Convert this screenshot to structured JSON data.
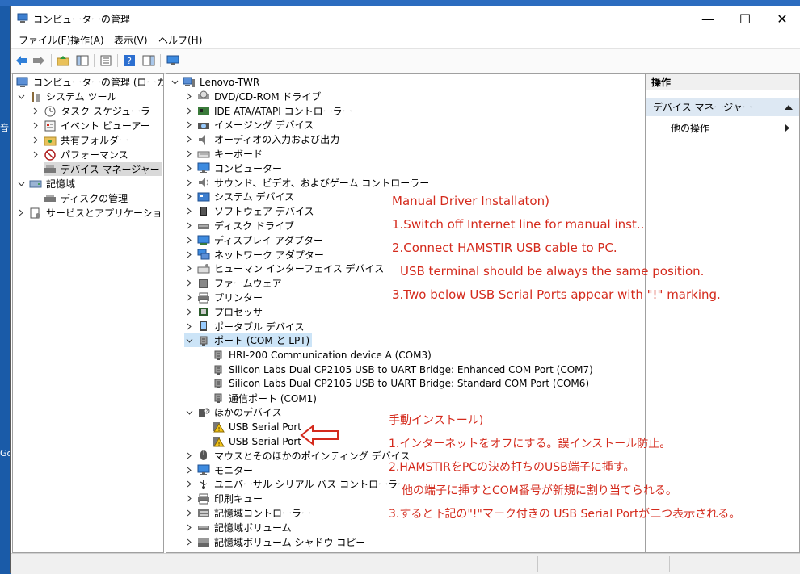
{
  "window": {
    "title": "コンピューターの管理",
    "minimize": "—",
    "maximize": "☐",
    "close": "✕"
  },
  "desktop_fragments": [
    "音",
    "Go"
  ],
  "menu": [
    "ファイル(F)",
    "操作(A)",
    "表示(V)",
    "ヘルプ(H)"
  ],
  "toolbar_icons": [
    "back-arrow-icon",
    "forward-arrow-icon",
    "up-folder-icon",
    "show-hide-tree-icon",
    "properties-icon",
    "help-icon",
    "action-pane-icon",
    "monitor-icon"
  ],
  "left_tree": [
    {
      "label": "コンピューターの管理 (ローカル)",
      "icon": "computer-management-icon",
      "indent": 0,
      "expander": ""
    },
    {
      "label": "システム ツール",
      "icon": "tools-icon",
      "indent": 1,
      "expander": "v"
    },
    {
      "label": "タスク スケジューラ",
      "icon": "clock-icon",
      "indent": 2,
      "expander": ">"
    },
    {
      "label": "イベント ビューアー",
      "icon": "event-viewer-icon",
      "indent": 2,
      "expander": ">"
    },
    {
      "label": "共有フォルダー",
      "icon": "shared-folder-icon",
      "indent": 2,
      "expander": ">"
    },
    {
      "label": "パフォーマンス",
      "icon": "performance-icon",
      "indent": 2,
      "expander": ">"
    },
    {
      "label": "デバイス マネージャー",
      "icon": "device-manager-icon",
      "indent": 2,
      "expander": "",
      "selected": true
    },
    {
      "label": "記憶域",
      "icon": "storage-icon",
      "indent": 1,
      "expander": "v"
    },
    {
      "label": "ディスクの管理",
      "icon": "disk-management-icon",
      "indent": 2,
      "expander": ""
    },
    {
      "label": "サービスとアプリケーション",
      "icon": "services-icon",
      "indent": 1,
      "expander": ">"
    }
  ],
  "device_tree": [
    {
      "label": "Lenovo-TWR",
      "icon": "computer-icon",
      "indent": 0,
      "expander": "v"
    },
    {
      "label": "DVD/CD-ROM ドライブ",
      "icon": "dvd-drive-icon",
      "indent": 1,
      "expander": ">"
    },
    {
      "label": "IDE ATA/ATAPI コントローラー",
      "icon": "ide-controller-icon",
      "indent": 1,
      "expander": ">"
    },
    {
      "label": "イメージング デバイス",
      "icon": "camera-icon",
      "indent": 1,
      "expander": ">"
    },
    {
      "label": "オーディオの入力および出力",
      "icon": "speaker-icon",
      "indent": 1,
      "expander": ">"
    },
    {
      "label": "キーボード",
      "icon": "keyboard-icon",
      "indent": 1,
      "expander": ">"
    },
    {
      "label": "コンピューター",
      "icon": "monitor-icon",
      "indent": 1,
      "expander": ">"
    },
    {
      "label": "サウンド、ビデオ、およびゲーム コントローラー",
      "icon": "sound-icon",
      "indent": 1,
      "expander": ">"
    },
    {
      "label": "システム デバイス",
      "icon": "system-device-icon",
      "indent": 1,
      "expander": ">"
    },
    {
      "label": "ソフトウェア デバイス",
      "icon": "software-device-icon",
      "indent": 1,
      "expander": ">"
    },
    {
      "label": "ディスク ドライブ",
      "icon": "disk-drive-icon",
      "indent": 1,
      "expander": ">"
    },
    {
      "label": "ディスプレイ アダプター",
      "icon": "display-adapter-icon",
      "indent": 1,
      "expander": ">"
    },
    {
      "label": "ネットワーク アダプター",
      "icon": "network-adapter-icon",
      "indent": 1,
      "expander": ">"
    },
    {
      "label": "ヒューマン インターフェイス デバイス",
      "icon": "hid-icon",
      "indent": 1,
      "expander": ">"
    },
    {
      "label": "ファームウェア",
      "icon": "firmware-icon",
      "indent": 1,
      "expander": ">"
    },
    {
      "label": "プリンター",
      "icon": "printer-icon",
      "indent": 1,
      "expander": ">"
    },
    {
      "label": "プロセッサ",
      "icon": "processor-icon",
      "indent": 1,
      "expander": ">"
    },
    {
      "label": "ポータブル デバイス",
      "icon": "portable-device-icon",
      "indent": 1,
      "expander": ">"
    },
    {
      "label": "ポート (COM と LPT)",
      "icon": "port-icon",
      "indent": 1,
      "expander": "v",
      "selected": true
    },
    {
      "label": "HRI-200 Communication device A (COM3)",
      "icon": "port-icon",
      "indent": 2,
      "expander": ""
    },
    {
      "label": "Silicon Labs Dual CP2105 USB to UART Bridge: Enhanced COM Port (COM7)",
      "icon": "port-icon",
      "indent": 2,
      "expander": ""
    },
    {
      "label": "Silicon Labs Dual CP2105 USB to UART Bridge: Standard COM Port (COM6)",
      "icon": "port-icon",
      "indent": 2,
      "expander": ""
    },
    {
      "label": "通信ポート (COM1)",
      "icon": "port-icon",
      "indent": 2,
      "expander": ""
    },
    {
      "label": "ほかのデバイス",
      "icon": "unknown-device-icon",
      "indent": 1,
      "expander": "v"
    },
    {
      "label": "USB Serial Port",
      "icon": "warning-device-icon",
      "indent": 2,
      "expander": ""
    },
    {
      "label": "USB Serial Port",
      "icon": "warning-device-icon",
      "indent": 2,
      "expander": ""
    },
    {
      "label": "マウスとそのほかのポインティング デバイス",
      "icon": "mouse-icon",
      "indent": 1,
      "expander": ">"
    },
    {
      "label": "モニター",
      "icon": "monitor-icon",
      "indent": 1,
      "expander": ">"
    },
    {
      "label": "ユニバーサル シリアル バス コントローラー",
      "icon": "usb-icon",
      "indent": 1,
      "expander": ">"
    },
    {
      "label": "印刷キュー",
      "icon": "print-queue-icon",
      "indent": 1,
      "expander": ">"
    },
    {
      "label": "記憶域コントローラー",
      "icon": "storage-controller-icon",
      "indent": 1,
      "expander": ">"
    },
    {
      "label": "記憶域ボリューム",
      "icon": "storage-volume-icon",
      "indent": 1,
      "expander": ">"
    },
    {
      "label": "記憶域ボリューム シャドウ コピー",
      "icon": "shadow-copy-icon",
      "indent": 1,
      "expander": ">"
    }
  ],
  "actions": {
    "header": "操作",
    "section": "デバイス マネージャー",
    "other": "他の操作"
  },
  "annotations_en": [
    "Manual Driver Installaton)",
    "1.Switch off Internet line for manual inst..",
    "2.Connect HAMSTIR USB cable to PC.",
    "USB terminal should be always the same position.",
    "3.Two below USB Serial Ports appear with \"!\" marking."
  ],
  "annotations_jp": [
    "手動インストール)",
    "1.インターネットをオフにする。誤インストール防止。",
    "2.HAMSTIRをPCの決め打ちのUSB端子に挿す。",
    "他の端子に挿すとCOM番号が新規に割り当てられる。",
    "3.すると下記の\"!\"マーク付きの USB Serial Portが二つ表示される。"
  ],
  "colors": {
    "annotation_red": "#d42a1c",
    "selection_blue": "#cce4f7",
    "desktop_blue": "#1a5ba8"
  }
}
